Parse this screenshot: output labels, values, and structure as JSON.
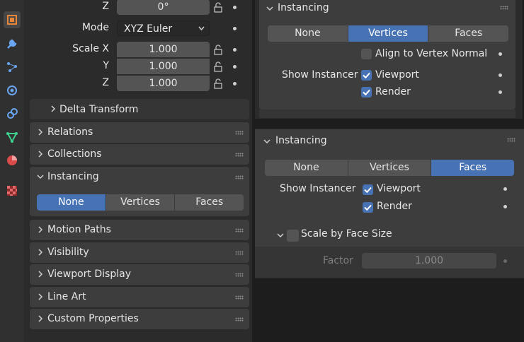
{
  "sidebar_tabs": [
    {
      "icon": "object-icon",
      "active": true
    },
    {
      "icon": "modifier-wrench-icon",
      "active": false
    },
    {
      "icon": "particles-icon",
      "active": false
    },
    {
      "icon": "physics-icon",
      "active": false
    },
    {
      "icon": "constraints-icon",
      "active": false
    },
    {
      "icon": "object-data-mesh-icon",
      "active": false
    },
    {
      "icon": "material-icon",
      "active": false
    },
    {
      "icon": "texture-checker-icon",
      "active": false
    }
  ],
  "transform": {
    "rotation_z_label": "Z",
    "rotation_z_value": "0°",
    "mode_label": "Mode",
    "mode_value": "XYZ Euler",
    "scale_x_label": "Scale X",
    "scale_x_value": "1.000",
    "scale_y_label": "Y",
    "scale_y_value": "1.000",
    "scale_z_label": "Z",
    "scale_z_value": "1.000",
    "delta_transform_label": "Delta Transform"
  },
  "panels": {
    "relations": "Relations",
    "collections": "Collections",
    "instancing": "Instancing",
    "motion_paths": "Motion Paths",
    "visibility": "Visibility",
    "viewport_display": "Viewport Display",
    "line_art": "Line Art",
    "custom_properties": "Custom Properties"
  },
  "left_instancing": {
    "options": [
      "None",
      "Vertices",
      "Faces"
    ],
    "selected": "None"
  },
  "right_top": {
    "title": "Instancing",
    "options": [
      "None",
      "Vertices",
      "Faces"
    ],
    "selected": "Vertices",
    "align_label": "Align to Vertex Normal",
    "show_instancer_label": "Show Instancer",
    "viewport_label": "Viewport",
    "render_label": "Render"
  },
  "right_bottom": {
    "title": "Instancing",
    "options": [
      "None",
      "Vertices",
      "Faces"
    ],
    "selected": "Faces",
    "show_instancer_label": "Show Instancer",
    "viewport_label": "Viewport",
    "render_label": "Render",
    "scale_by_face_label": "Scale by Face Size",
    "factor_label": "Factor",
    "factor_value": "1.000"
  },
  "colors": {
    "accent": "#4772b3",
    "panel": "#3d3d3d",
    "field": "#545454"
  }
}
